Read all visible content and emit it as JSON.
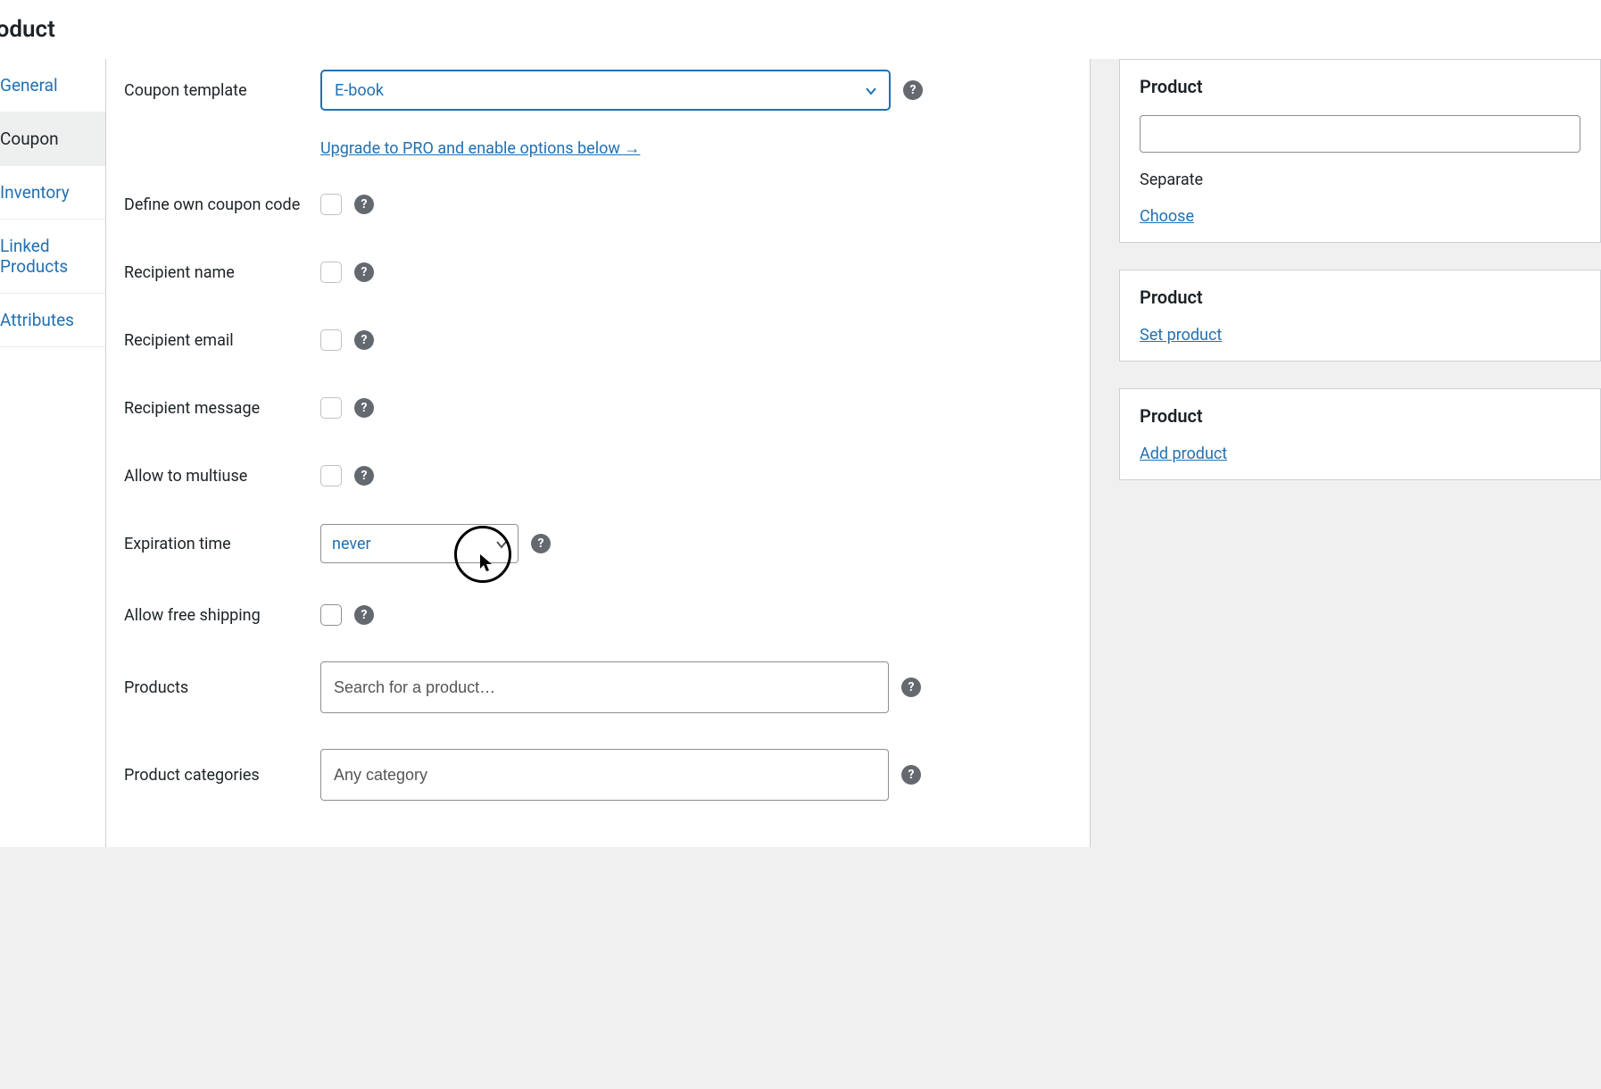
{
  "page": {
    "title": "Product"
  },
  "sidebar": {
    "items": [
      {
        "label": "General"
      },
      {
        "label": "Coupon"
      },
      {
        "label": "Inventory"
      },
      {
        "label": "Linked Products"
      },
      {
        "label": "Attributes"
      }
    ]
  },
  "form": {
    "coupon_template": {
      "label": "Coupon template",
      "value": "E-book"
    },
    "upgrade_link": "Upgrade to PRO and enable options below →",
    "define_own": {
      "label": "Define own coupon code"
    },
    "recipient_name": {
      "label": "Recipient name"
    },
    "recipient_email": {
      "label": "Recipient email"
    },
    "recipient_message": {
      "label": "Recipient message"
    },
    "allow_multiuse": {
      "label": "Allow to multiuse"
    },
    "expiration_time": {
      "label": "Expiration time",
      "value": "never"
    },
    "allow_free_shipping": {
      "label": "Allow free shipping"
    },
    "products": {
      "label": "Products",
      "placeholder": "Search for a product…"
    },
    "product_categories": {
      "label": "Product categories",
      "placeholder": "Any category"
    }
  },
  "right": {
    "box1": {
      "title": "Product",
      "hint": "Separate",
      "link": "Choose"
    },
    "box2": {
      "title": "Product",
      "link": "Set product"
    },
    "box3": {
      "title": "Product",
      "link": "Add product"
    }
  }
}
